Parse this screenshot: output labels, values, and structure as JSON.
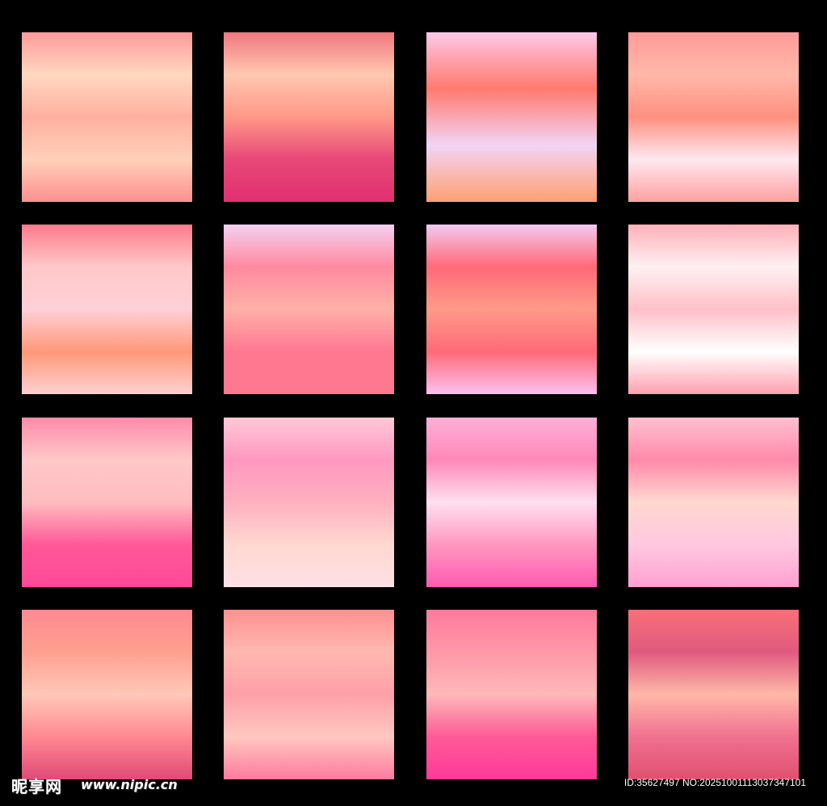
{
  "swatches": [
    {
      "stops": [
        "#ff9a9a",
        "#ffd8c0",
        "#ffb0a0",
        "#ffd0b8",
        "#ff9090"
      ]
    },
    {
      "stops": [
        "#f07880",
        "#ffc8b0",
        "#ff9888",
        "#e84878",
        "#e03070"
      ]
    },
    {
      "stops": [
        "#ffc8e8",
        "#ff7a6e",
        "#f2d4f4",
        "#ffa070"
      ]
    },
    {
      "stops": [
        "#ff9a9a",
        "#ffb8a8",
        "#ff9080",
        "#ffe8f0",
        "#ffa0a0"
      ]
    },
    {
      "stops": [
        "#ff7a8a",
        "#ffc8c8",
        "#ffd0d8",
        "#ff9878",
        "#ffd0d0"
      ]
    },
    {
      "stops": [
        "#f4d0f0",
        "#ff8aa0",
        "#ffb0a8",
        "#ff7890",
        "#ff7890"
      ]
    },
    {
      "stops": [
        "#f4c8f0",
        "#ff6a78",
        "#ff9a88",
        "#ff6a78",
        "#ffc0f0"
      ]
    },
    {
      "stops": [
        "#ffb0b8",
        "#fff0f2",
        "#ffc0c8",
        "#ffffff",
        "#ffa0b0"
      ]
    },
    {
      "stops": [
        "#ff8aaa",
        "#ffc8c8",
        "#ffbcc0",
        "#ff5898",
        "#ff4898"
      ]
    },
    {
      "stops": [
        "#ffc8d8",
        "#ff98c0",
        "#ffb0c0",
        "#ffd8d0",
        "#ffe0e8"
      ]
    },
    {
      "stops": [
        "#ffb0d8",
        "#ff88b8",
        "#ffe0f0",
        "#ff98c0",
        "#ff5ab0"
      ]
    },
    {
      "stops": [
        "#ffc0d0",
        "#ff8aaa",
        "#ffd8d0",
        "#ffc8e0",
        "#ffa0d0"
      ]
    },
    {
      "stops": [
        "#ff8a90",
        "#ffa090",
        "#ffc8b8",
        "#ff8890",
        "#e04a78"
      ]
    },
    {
      "stops": [
        "#ff9090",
        "#ffb8b0",
        "#ffa0a8",
        "#ffc8c0",
        "#ff7aa0"
      ]
    },
    {
      "stops": [
        "#ff7a9a",
        "#ff98a8",
        "#ffb8b8",
        "#ff5a98",
        "#ff3a98"
      ]
    },
    {
      "stops": [
        "#f87078",
        "#e05a80",
        "#ffb8a8",
        "#f07090",
        "#e05070"
      ]
    }
  ],
  "watermark": {
    "logo": "昵享网",
    "url": "www.nipic.cn",
    "id": "ID:35627497 NO:20251001113037347101"
  }
}
